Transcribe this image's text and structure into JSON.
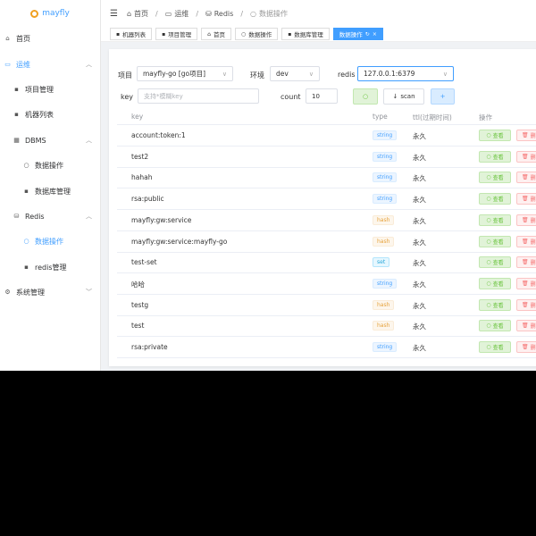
{
  "logo": {
    "text": "mayfly"
  },
  "sidebar": {
    "items": [
      {
        "label": "首页",
        "icon": "home-icon"
      },
      {
        "label": "运维",
        "icon": "monitor-icon"
      },
      {
        "label": "项目管理",
        "icon": "grid-icon"
      },
      {
        "label": "机器列表",
        "icon": "grid-icon"
      },
      {
        "label": "DBMS",
        "icon": "grid-icon"
      },
      {
        "label": "数据操作",
        "icon": "search-icon"
      },
      {
        "label": "数据库管理",
        "icon": "grid-icon"
      },
      {
        "label": "Redis",
        "icon": "database-icon"
      },
      {
        "label": "数据操作",
        "icon": "search-icon"
      },
      {
        "label": "redis管理",
        "icon": "grid-icon"
      },
      {
        "label": "系统管理",
        "icon": "gear-icon"
      }
    ]
  },
  "breadcrumb": {
    "items": [
      "首页",
      "运维",
      "Redis",
      "数据操作"
    ]
  },
  "tabs": [
    {
      "label": "机器列表"
    },
    {
      "label": "项目管理"
    },
    {
      "label": "首页"
    },
    {
      "label": "数据操作"
    },
    {
      "label": "数据库管理"
    },
    {
      "label": "数据操作",
      "active": true
    }
  ],
  "filters": {
    "project_label": "项目",
    "project_value": "mayfly-go [go项目]",
    "env_label": "环境",
    "env_value": "dev",
    "redis_label": "redis",
    "redis_value": "127.0.0.1:6379",
    "key_label": "key",
    "key_placeholder": "支持*模糊key",
    "count_label": "count",
    "count_value": "10",
    "scan_label": "scan",
    "add_label": "+"
  },
  "table": {
    "headers": {
      "key": "key",
      "type": "type",
      "ttl": "ttl(过期时间)",
      "ops": "操作"
    },
    "view_label": "查看",
    "delete_label": "删除",
    "rows": [
      {
        "key": "account:token:1",
        "type": "string",
        "ttl": "永久"
      },
      {
        "key": "test2",
        "type": "string",
        "ttl": "永久"
      },
      {
        "key": "hahah",
        "type": "string",
        "ttl": "永久"
      },
      {
        "key": "rsa:public",
        "type": "string",
        "ttl": "永久"
      },
      {
        "key": "mayfly:gw:service",
        "type": "hash",
        "ttl": "永久"
      },
      {
        "key": "mayfly:gw:service:mayfly-go",
        "type": "hash",
        "ttl": "永久"
      },
      {
        "key": "test-set",
        "type": "set",
        "ttl": "永久"
      },
      {
        "key": "哈哈",
        "type": "string",
        "ttl": "永久"
      },
      {
        "key": "testg",
        "type": "hash",
        "ttl": "永久"
      },
      {
        "key": "test",
        "type": "hash",
        "ttl": "永久"
      },
      {
        "key": "rsa:private",
        "type": "string",
        "ttl": "永久"
      }
    ]
  },
  "colors": {
    "primary": "#409eff",
    "success": "#67c23a",
    "danger": "#f56c6c",
    "warning": "#e6a23c"
  }
}
